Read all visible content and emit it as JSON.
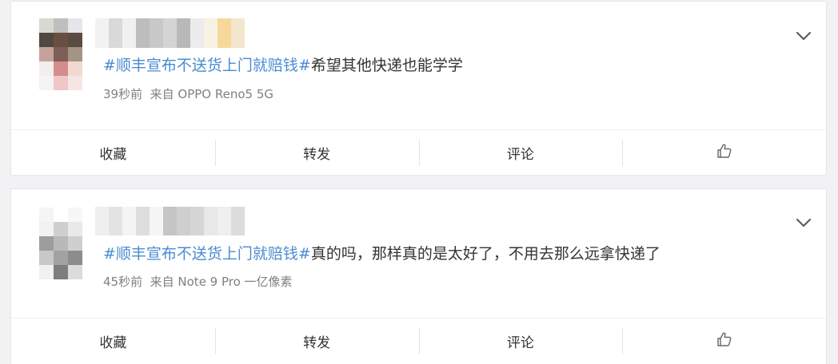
{
  "posts": [
    {
      "topic": "#顺丰宣布不送货上门就赔钱#",
      "text": "希望其他快递也能学学",
      "time": "39秒前",
      "source": "来自 OPPO Reno5 5G",
      "actions": {
        "favorite": "收藏",
        "repost": "转发",
        "comment": "评论",
        "like_icon": "thumbs-up-icon"
      },
      "avatar_pixels": [
        "#d9d9d2",
        "#bfbfbf",
        "#e8e4ec",
        "#4f4742",
        "#6b4e42",
        "#5a4b44",
        "#c6a29a",
        "#7d5f57",
        "#a59482",
        "#f2eeee",
        "#d58c8c",
        "#f1d9d2",
        "#f4f4f4",
        "#efc7c9",
        "#f5e5e4"
      ],
      "name_blur": [
        "#f2f2f2",
        "#d9d9d9",
        "#f0f0f0",
        "#bdbdbd",
        "#c8c8c8",
        "#d4d4d4",
        "#b8b8b8",
        "#ececec",
        "#f7f2e3",
        "#f8d89a",
        "#f2e6cc"
      ]
    },
    {
      "topic": "#顺丰宣布不送货上门就赔钱#",
      "text": "真的吗，那样真的是太好了，不用去那么远拿快递了",
      "time": "45秒前",
      "source": "来自 Note 9 Pro 一亿像素",
      "actions": {
        "favorite": "收藏",
        "repost": "转发",
        "comment": "评论",
        "like_icon": "thumbs-up-icon"
      },
      "avatar_pixels": [
        "#f5f5f5",
        "#ffffff",
        "#f7f7f7",
        "#f2f2f2",
        "#cfcfcf",
        "#e9e9e9",
        "#9d9d9d",
        "#b9b9b9",
        "#cfcfcf",
        "#c8c8c8",
        "#a2a2a2",
        "#8c8c8c",
        "#f1f1f1",
        "#7d7d7d",
        "#dcdcdc"
      ],
      "name_blur": [
        "#efefef",
        "#e3e3e3",
        "#f4f4f4",
        "#dedede",
        "#f5f5f5",
        "#c5c5c5",
        "#cfcfcf",
        "#d6d6d6",
        "#e8e8e8",
        "#efefef",
        "#dcdcdc"
      ]
    }
  ],
  "colors": {
    "topic": "#4a8bd1",
    "text": "#333333",
    "meta": "#808080",
    "background": "#f2f2f5"
  },
  "icons": {
    "menu": "chevron-down-icon"
  }
}
